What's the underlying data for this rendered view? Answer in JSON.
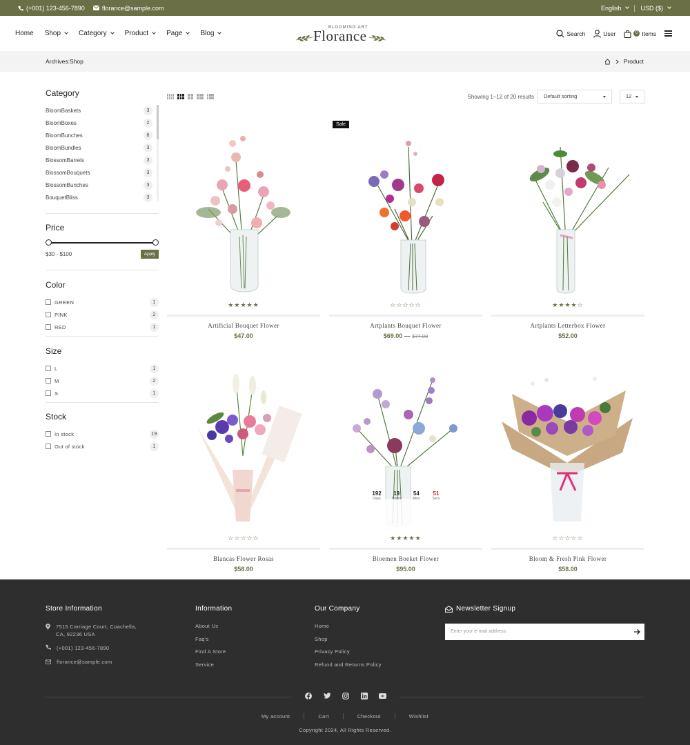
{
  "topbar": {
    "phone": "(+001) 123-456-7890",
    "email": "florance@sample.com",
    "language": "English",
    "currency": "USD ($)"
  },
  "header": {
    "nav": [
      "Home",
      "Shop",
      "Category",
      "Product",
      "Page",
      "Blog"
    ],
    "logo_tag": "BLOOMING ART",
    "logo_name": "Florance",
    "search_label": "Search",
    "user_label": "User",
    "cart_count": "0",
    "cart_label": "Items"
  },
  "breadcrumb": {
    "title": "Archives:Shop",
    "current": "Product"
  },
  "sidebar": {
    "category_title": "Category",
    "categories": [
      {
        "name": "BloomBaskets",
        "count": "3"
      },
      {
        "name": "BloomBoxes",
        "count": "2"
      },
      {
        "name": "BloomBunches",
        "count": "6"
      },
      {
        "name": "BloomBundles",
        "count": "3"
      },
      {
        "name": "BlossomBarrels",
        "count": "3"
      },
      {
        "name": "BlossomBouquets",
        "count": "3"
      },
      {
        "name": "BlossomBunches",
        "count": "3"
      },
      {
        "name": "BouquetBliss",
        "count": "3"
      }
    ],
    "price_title": "Price",
    "price_range": "$30 - $100",
    "apply_label": "Apply",
    "color_title": "Color",
    "colors": [
      {
        "name": "GREEN",
        "count": "1"
      },
      {
        "name": "PINK",
        "count": "2"
      },
      {
        "name": "RED",
        "count": "1"
      }
    ],
    "size_title": "Size",
    "sizes": [
      {
        "name": "L",
        "count": "1"
      },
      {
        "name": "M",
        "count": "2"
      },
      {
        "name": "S",
        "count": "1"
      }
    ],
    "stock_title": "Stock",
    "stock": [
      {
        "name": "In stock",
        "count": "19"
      },
      {
        "name": "Out of stock",
        "count": "1"
      }
    ]
  },
  "toolbar": {
    "showing": "Showing 1–12 of 20 results",
    "sort": "Default sorting",
    "per_page": "12"
  },
  "products": [
    {
      "name": "Artificial Bouquet Flower",
      "price": "$47.00",
      "old_price": "",
      "rating": 5,
      "sale": ""
    },
    {
      "name": "Artplants Bouquet Flower",
      "price": "$69.00",
      "old_price": "$77.00",
      "rating": 0,
      "sale": "Sale"
    },
    {
      "name": "Artplants Letterbox Flower",
      "price": "$52.00",
      "old_price": "",
      "rating": 4,
      "sale": ""
    },
    {
      "name": "Blancas Flower Rosas",
      "price": "$58.00",
      "old_price": "",
      "rating": 0,
      "sale": ""
    },
    {
      "name": "Bloemen Boeket Flower",
      "price": "$95.00",
      "old_price": "",
      "rating": 5,
      "sale": ""
    },
    {
      "name": "Bloom & Fresh Pink Flower",
      "price": "$58.00",
      "old_price": "",
      "rating": 0,
      "sale": ""
    }
  ],
  "countdown": [
    {
      "n": "192",
      "u": "Days"
    },
    {
      "n": "19",
      "u": "Hours"
    },
    {
      "n": "54",
      "u": "Mins"
    },
    {
      "n": "51",
      "u": "Secs"
    }
  ],
  "footer": {
    "store_title": "Store Information",
    "address": "7515 Carriage Court, Coachella, CA, 92236 USA",
    "phone": "(+001) 123-456-7890",
    "email": "florance@sample.com",
    "info_title": "Information",
    "info_links": [
      "About Us",
      "Faq's",
      "Find A Store",
      "Service"
    ],
    "company_title": "Our Company",
    "company_links": [
      "Home",
      "Shop",
      "Privacy Policy",
      "Refund and Returns Policy"
    ],
    "newsletter_title": "Newsletter Signup",
    "newsletter_placeholder": "Enter your e-mail address",
    "bottom_links": [
      "My account",
      "Cart",
      "Checkout",
      "Wishlist"
    ],
    "copyright": "Copyright 2024, All Rights Reserved."
  },
  "colors": {
    "accent": "#6b6f45",
    "footer_bg": "#2e2e2e",
    "crumb_bg": "#f3f3f3"
  }
}
